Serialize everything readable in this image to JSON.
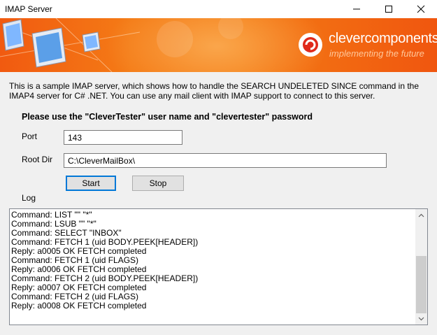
{
  "window": {
    "title": "IMAP Server"
  },
  "banner": {
    "brand_name": "clevercomponents",
    "brand_tagline": "implementing the future"
  },
  "description": "This is a sample IMAP server, which shows how to handle the SEARCH UNDELETED SINCE command in the IMAP4 server for C# .NET. You can use any mail client with IMAP support to connect to this server.",
  "notice": "Please use the \"CleverTester\" user name and \"clevertester\" password",
  "form": {
    "port_label": "Port",
    "port_value": "143",
    "rootdir_label": "Root Dir",
    "rootdir_value": "C:\\CleverMailBox\\",
    "start_label": "Start",
    "stop_label": "Stop",
    "log_label": "Log"
  },
  "log": [
    "Command: LIST \"\" \"*\"",
    "Command: LSUB \"\" \"*\"",
    "Command: SELECT \"INBOX\"",
    "Command: FETCH 1 (uid BODY.PEEK[HEADER])",
    "Reply: a0005 OK FETCH completed",
    "Command: FETCH 1 (uid FLAGS)",
    "Reply: a0006 OK FETCH completed",
    "Command: FETCH 2 (uid BODY.PEEK[HEADER])",
    "Reply: a0007 OK FETCH completed",
    "Command: FETCH 2 (uid FLAGS)",
    "Reply: a0008 OK FETCH completed"
  ]
}
